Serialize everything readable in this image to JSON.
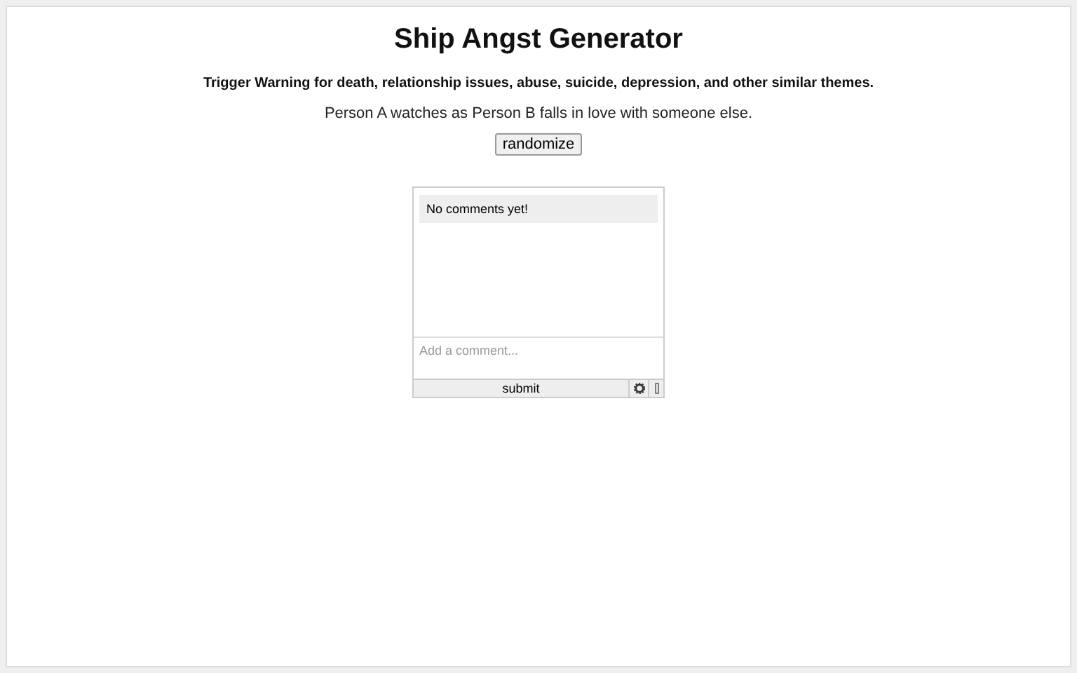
{
  "title": "Ship Angst Generator",
  "warning": "Trigger Warning for death, relationship issues, abuse, suicide, depression, and other similar themes.",
  "prompt": "Person A watches as Person B falls in love with someone else.",
  "randomize_button": "randomize",
  "comments": {
    "empty_message": "No comments yet!",
    "placeholder": "Add a comment...",
    "submit_button": "submit"
  }
}
